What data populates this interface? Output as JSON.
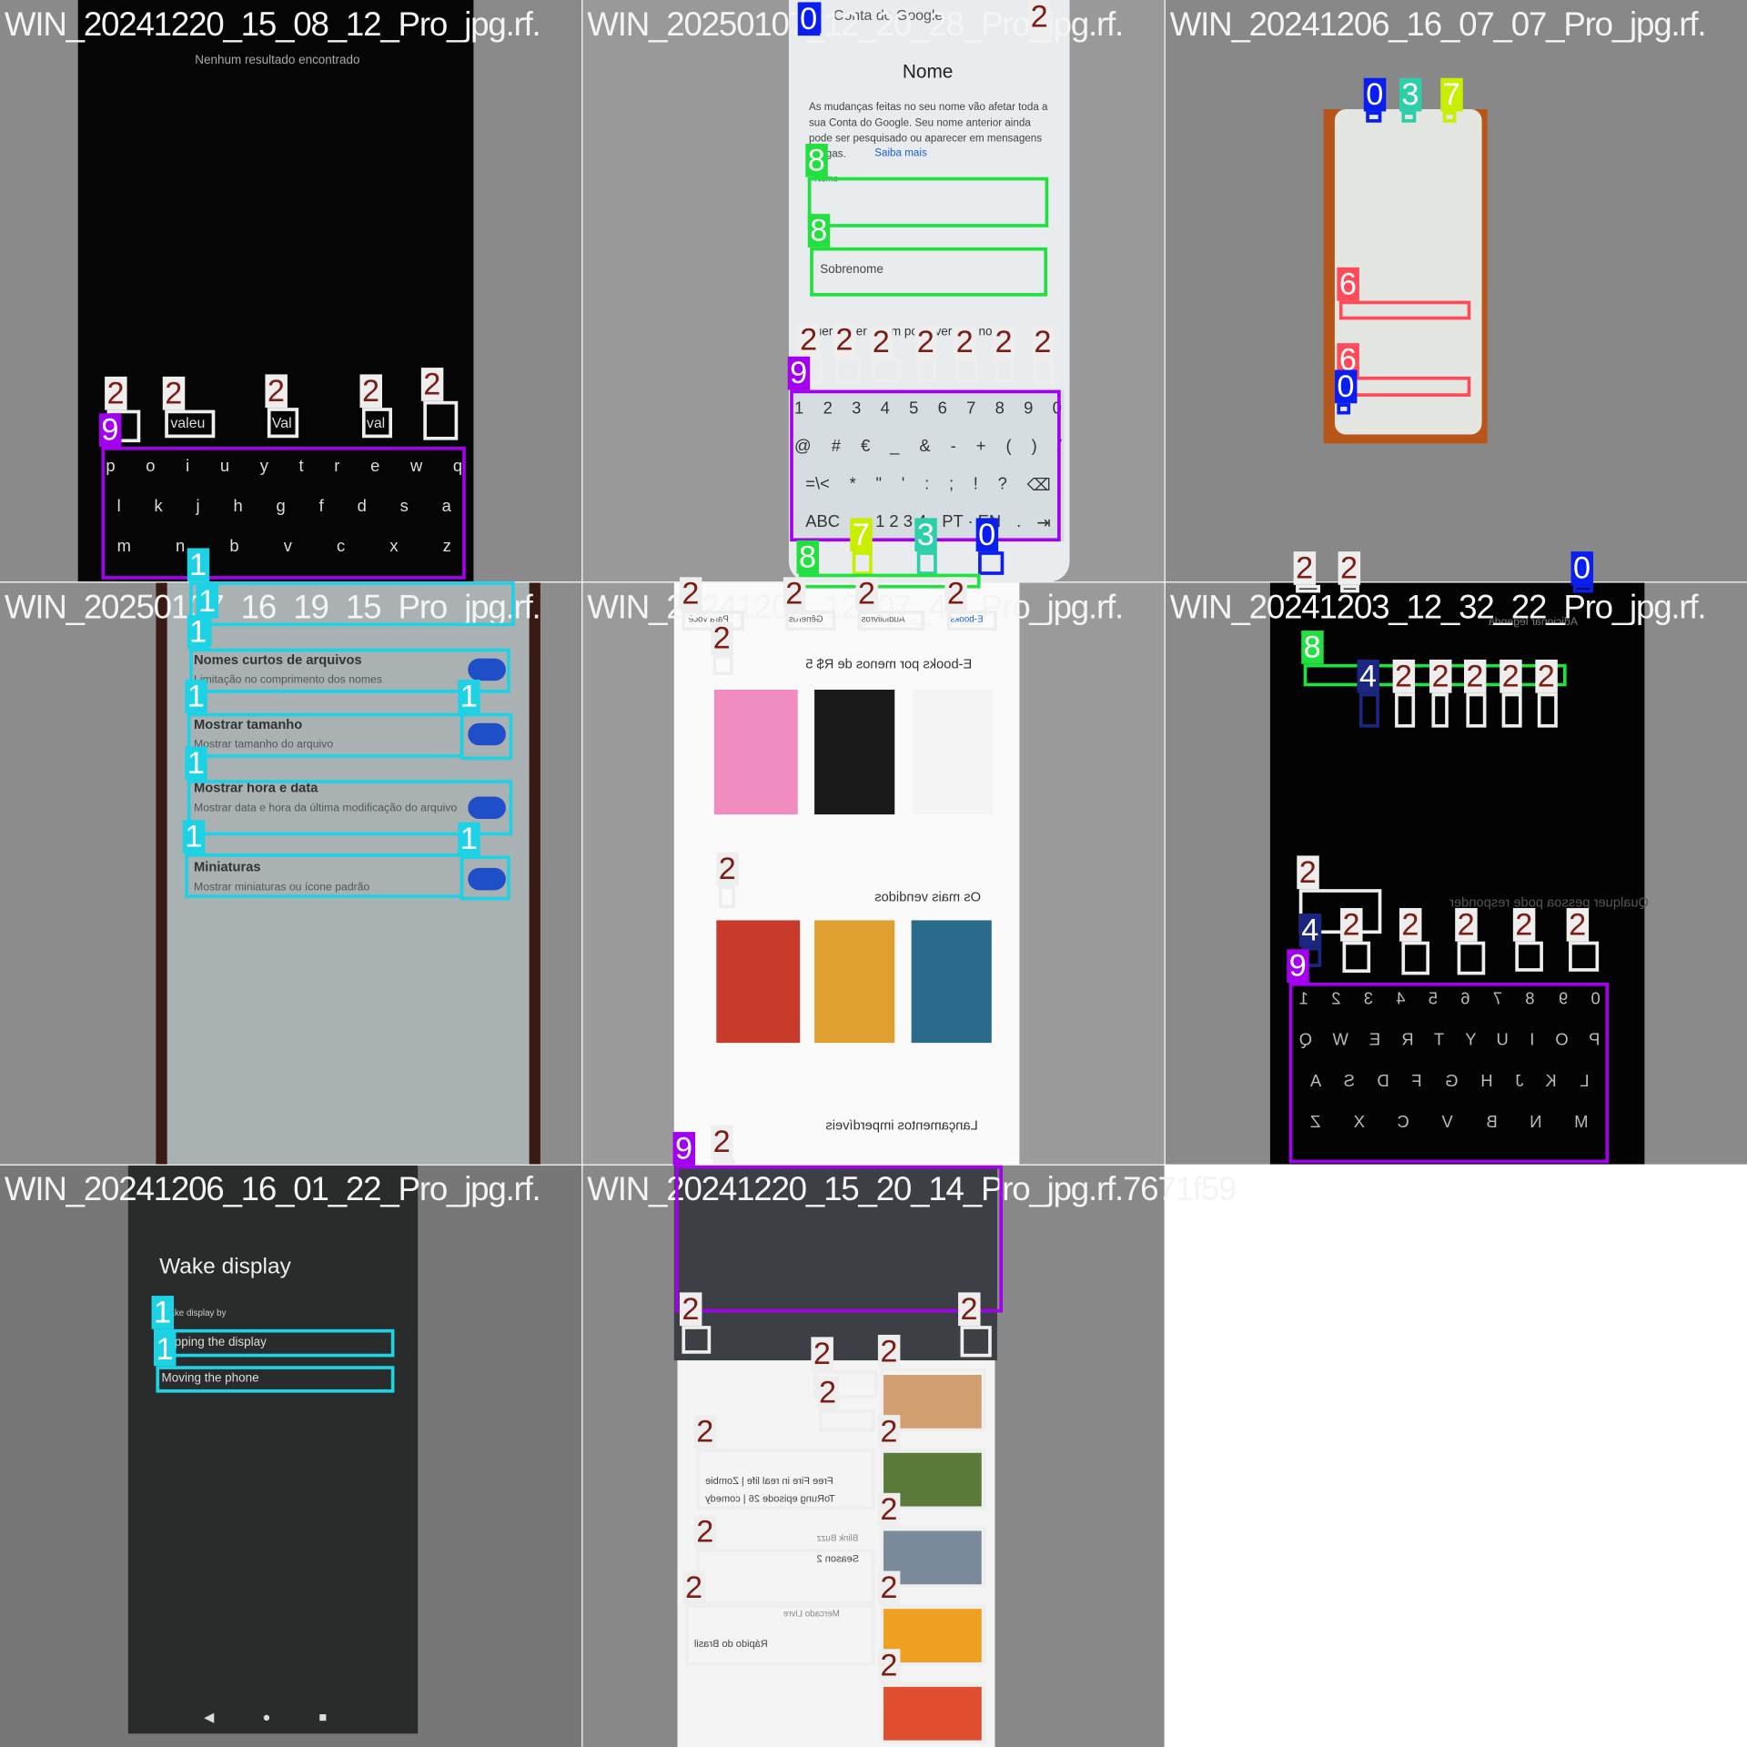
{
  "class_colors": {
    "0": {
      "box": "#0A1EF0",
      "text": "#ffffff"
    },
    "1": {
      "box": "#1ED2E6",
      "text": "#ffffff"
    },
    "2": {
      "box": "#EEEEEE",
      "text": "#7A1E16"
    },
    "3": {
      "box": "#2CCFA8",
      "text": "#ffffff"
    },
    "4": {
      "box": "#1A2680",
      "text": "#ffffff"
    },
    "6": {
      "box": "#FF4A5A",
      "text": "#ffffff"
    },
    "7": {
      "box": "#C8EE00",
      "text": "#ffffff"
    },
    "8": {
      "box": "#22E040",
      "text": "#ffffff"
    },
    "9": {
      "box": "#A300F0",
      "text": "#ffffff"
    }
  },
  "tiles": [
    {
      "filename": "WIN_20241220_15_08_12_Pro_jpg.rf.",
      "texts": [
        "Nenhum resultado encontrado",
        "valeu",
        "Val",
        "val"
      ],
      "keyboard_rows": [
        [
          "p",
          "o",
          "i",
          "u",
          "y",
          "t",
          "r",
          "e",
          "w",
          "q"
        ],
        [
          "l",
          "k",
          "j",
          "h",
          "g",
          "f",
          "d",
          "s",
          "a"
        ],
        [
          "m",
          "n",
          "b",
          "v",
          "c",
          "x",
          "z"
        ]
      ],
      "boxes": [
        "2",
        "2",
        "2",
        "2",
        "2",
        "9"
      ]
    },
    {
      "filename": "WIN_20250107_12_20_28_Pro_jpg.rf.",
      "texts": [
        "Conta do Google",
        "Nome",
        "As mudanças feitas no seu nome vão afetar toda a sua Conta do Google. Seu nome anterior ainda pode ser pesquisado ou aparecer em mensagens antigas.",
        "Saiba mais",
        "Nome",
        "Sobrenome",
        "Quer saber quem pode ver seu nome"
      ],
      "keyboard_rows": [
        [
          "1",
          "2",
          "3",
          "4",
          "5",
          "6",
          "7",
          "8",
          "9",
          "0"
        ],
        [
          "@",
          "#",
          "€",
          "_",
          "&",
          "-",
          "+",
          "(",
          ")",
          "/"
        ],
        [
          "=\\<",
          "*",
          "\"",
          "'",
          ":",
          ";",
          "!",
          "?",
          "⌫"
        ],
        [
          "ABC",
          ",",
          "1 2 3 4",
          "PT · EN",
          ".",
          "⇥"
        ]
      ],
      "boxes": [
        "0",
        "2",
        "8",
        "8",
        "2",
        "2",
        "2",
        "2",
        "2",
        "2",
        "2",
        "9",
        "7",
        "3",
        "0",
        "8"
      ]
    },
    {
      "filename": "WIN_20241206_16_07_07_Pro_jpg.rf.",
      "texts": [],
      "boxes": [
        "0",
        "3",
        "7",
        "6",
        "6",
        "0"
      ]
    },
    {
      "filename": "WIN_20250107_16_19_15_Pro_jpg.rf.",
      "texts": [
        "Nomes curtos de arquivos",
        "Limitação no comprimento dos nomes",
        "Mostrar tamanho",
        "Mostrar tamanho do arquivo",
        "Mostrar hora e data",
        "Mostrar data e hora da última modificação do arquivo",
        "Miniaturas",
        "Mostrar miniaturas ou ícone padrão"
      ],
      "boxes": [
        "1",
        "1",
        "1",
        "1",
        "1",
        "1",
        "1",
        "1"
      ]
    },
    {
      "filename": "WIN_20241203_12_07_40_Pro_jpg.rf.",
      "texts": [
        "E-books por menos de R$ 5",
        "Os mais vendidos",
        "Lançamentos imperdíveis",
        "Para você",
        "Gêneros",
        "Audiolivros",
        "E-books"
      ],
      "boxes": [
        "2",
        "2",
        "2",
        "2",
        "2",
        "2",
        "2"
      ]
    },
    {
      "filename": "WIN_20241203_12_32_22_Pro_jpg.rf.",
      "texts": [
        "Qualquer pessoa pode responder",
        "Adicionar legenda"
      ],
      "keyboard_rows": [
        [
          "1",
          "2",
          "3",
          "4",
          "5",
          "6",
          "7",
          "8",
          "9",
          "0"
        ],
        [
          "Q",
          "W",
          "E",
          "R",
          "T",
          "Y",
          "U",
          "I",
          "O",
          "P"
        ],
        [
          "A",
          "S",
          "D",
          "F",
          "G",
          "H",
          "J",
          "K",
          "L"
        ],
        [
          "Z",
          "X",
          "C",
          "V",
          "B",
          "N",
          "M"
        ]
      ],
      "boxes": [
        "2",
        "2",
        "0",
        "8",
        "4",
        "2",
        "2",
        "2",
        "2",
        "2",
        "2",
        "4",
        "2",
        "2",
        "2",
        "2",
        "2",
        "9"
      ]
    },
    {
      "filename": "WIN_20241206_16_01_22_Pro_jpg.rf.",
      "texts": [
        "Wake display",
        "Wake display by",
        "Tapping the display",
        "Moving the phone"
      ],
      "boxes": [
        "1",
        "1"
      ]
    },
    {
      "filename": "WIN_20241220_15_20_14_Pro_jpg.rf.7671f59",
      "texts": [
        "Rápido do Brasil",
        "Mercado Livre",
        "Blink Buzz",
        "Season 2",
        "ToRung episode 26 | comedy",
        "Free Fire in real life | Zombie"
      ],
      "boxes": [
        "9",
        "2",
        "2",
        "2",
        "2",
        "2",
        "2",
        "2",
        "2",
        "2",
        "2",
        "2",
        "2"
      ]
    }
  ]
}
